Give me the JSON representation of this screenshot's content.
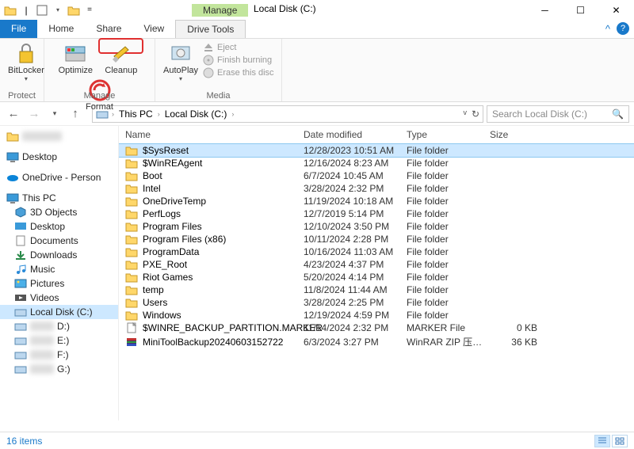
{
  "window": {
    "title": "Local Disk (C:)",
    "context_tab_title": "Manage"
  },
  "tabs": {
    "file": "File",
    "home": "Home",
    "share": "Share",
    "view": "View",
    "drive_tools": "Drive Tools"
  },
  "ribbon": {
    "protect": {
      "label": "Protect",
      "bitlocker": "BitLocker"
    },
    "manage": {
      "label": "Manage",
      "optimize": "Optimize",
      "cleanup": "Cleanup",
      "format": "Format"
    },
    "media": {
      "label": "Media",
      "autoplay": "AutoPlay",
      "eject": "Eject",
      "finish": "Finish burning",
      "erase": "Erase this disc"
    }
  },
  "address": {
    "this_pc": "This PC",
    "local_disk": "Local Disk (C:)",
    "search_placeholder": "Search Local Disk (C:)"
  },
  "nav": {
    "desktop": "Desktop",
    "onedrive": "OneDrive - Person",
    "this_pc": "This PC",
    "objects3d": "3D Objects",
    "desktop2": "Desktop",
    "documents": "Documents",
    "downloads": "Downloads",
    "music": "Music",
    "pictures": "Pictures",
    "videos": "Videos",
    "local_disk": "Local Disk (C:)",
    "drive_d": "D:)",
    "drive_e": "E:)",
    "drive_f": "F:)",
    "drive_g": "G:)"
  },
  "columns": {
    "name": "Name",
    "date": "Date modified",
    "type": "Type",
    "size": "Size"
  },
  "rows": [
    {
      "name": "$SysReset",
      "date": "12/28/2023 10:51 AM",
      "type": "File folder",
      "size": "",
      "icon": "folder",
      "sel": true
    },
    {
      "name": "$WinREAgent",
      "date": "12/16/2024 8:23 AM",
      "type": "File folder",
      "size": "",
      "icon": "folder"
    },
    {
      "name": "Boot",
      "date": "6/7/2024 10:45 AM",
      "type": "File folder",
      "size": "",
      "icon": "folder"
    },
    {
      "name": "Intel",
      "date": "3/28/2024 2:32 PM",
      "type": "File folder",
      "size": "",
      "icon": "folder"
    },
    {
      "name": "OneDriveTemp",
      "date": "11/19/2024 10:18 AM",
      "type": "File folder",
      "size": "",
      "icon": "folder"
    },
    {
      "name": "PerfLogs",
      "date": "12/7/2019 5:14 PM",
      "type": "File folder",
      "size": "",
      "icon": "folder"
    },
    {
      "name": "Program Files",
      "date": "12/10/2024 3:50 PM",
      "type": "File folder",
      "size": "",
      "icon": "folder"
    },
    {
      "name": "Program Files (x86)",
      "date": "10/11/2024 2:28 PM",
      "type": "File folder",
      "size": "",
      "icon": "folder"
    },
    {
      "name": "ProgramData",
      "date": "10/16/2024 11:03 AM",
      "type": "File folder",
      "size": "",
      "icon": "folder"
    },
    {
      "name": "PXE_Root",
      "date": "4/23/2024 4:37 PM",
      "type": "File folder",
      "size": "",
      "icon": "folder"
    },
    {
      "name": "Riot Games",
      "date": "5/20/2024 4:14 PM",
      "type": "File folder",
      "size": "",
      "icon": "folder"
    },
    {
      "name": "temp",
      "date": "11/8/2024 11:44 AM",
      "type": "File folder",
      "size": "",
      "icon": "folder"
    },
    {
      "name": "Users",
      "date": "3/28/2024 2:25 PM",
      "type": "File folder",
      "size": "",
      "icon": "folder"
    },
    {
      "name": "Windows",
      "date": "12/19/2024 4:59 PM",
      "type": "File folder",
      "size": "",
      "icon": "folder"
    },
    {
      "name": "$WINRE_BACKUP_PARTITION.MARKER",
      "date": "11/14/2024 2:32 PM",
      "type": "MARKER File",
      "size": "0 KB",
      "icon": "file"
    },
    {
      "name": "MiniToolBackup20240603152722",
      "date": "6/3/2024 3:27 PM",
      "type": "WinRAR ZIP 压缩...",
      "size": "36 KB",
      "icon": "zip"
    }
  ],
  "status": {
    "count": "16 items"
  }
}
